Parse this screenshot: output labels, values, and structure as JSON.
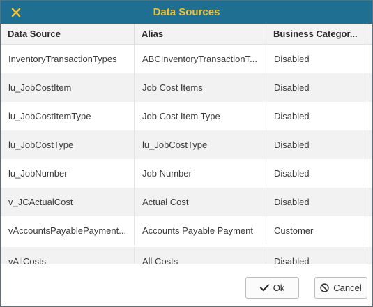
{
  "dialog": {
    "title": "Data Sources",
    "close_icon": "close-icon"
  },
  "table": {
    "columns": [
      "Data Source",
      "Alias",
      "Business Categor..."
    ],
    "rows": [
      {
        "source": "InventoryTransactionTypes",
        "alias": "ABCInventoryTransactionT...",
        "category": "Disabled"
      },
      {
        "source": "lu_JobCostItem",
        "alias": "Job Cost Items",
        "category": "Disabled"
      },
      {
        "source": "lu_JobCostItemType",
        "alias": "Job Cost Item Type",
        "category": "Disabled"
      },
      {
        "source": "lu_JobCostType",
        "alias": "lu_JobCostType",
        "category": "Disabled"
      },
      {
        "source": "lu_JobNumber",
        "alias": "Job Number",
        "category": "Disabled"
      },
      {
        "source": "v_JCActualCost",
        "alias": "Actual Cost",
        "category": "Disabled"
      },
      {
        "source": "vAccountsPayablePayment...",
        "alias": "Accounts Payable Payment",
        "category": "Customer"
      },
      {
        "source": "vAllCosts",
        "alias": "All Costs",
        "category": "Disabled"
      }
    ]
  },
  "footer": {
    "ok_label": "Ok",
    "cancel_label": "Cancel",
    "ok_icon": "checkmark-icon",
    "cancel_icon": "cancel-icon"
  },
  "colors": {
    "titlebar": "#1e6f91",
    "title_text": "#f2c232"
  }
}
